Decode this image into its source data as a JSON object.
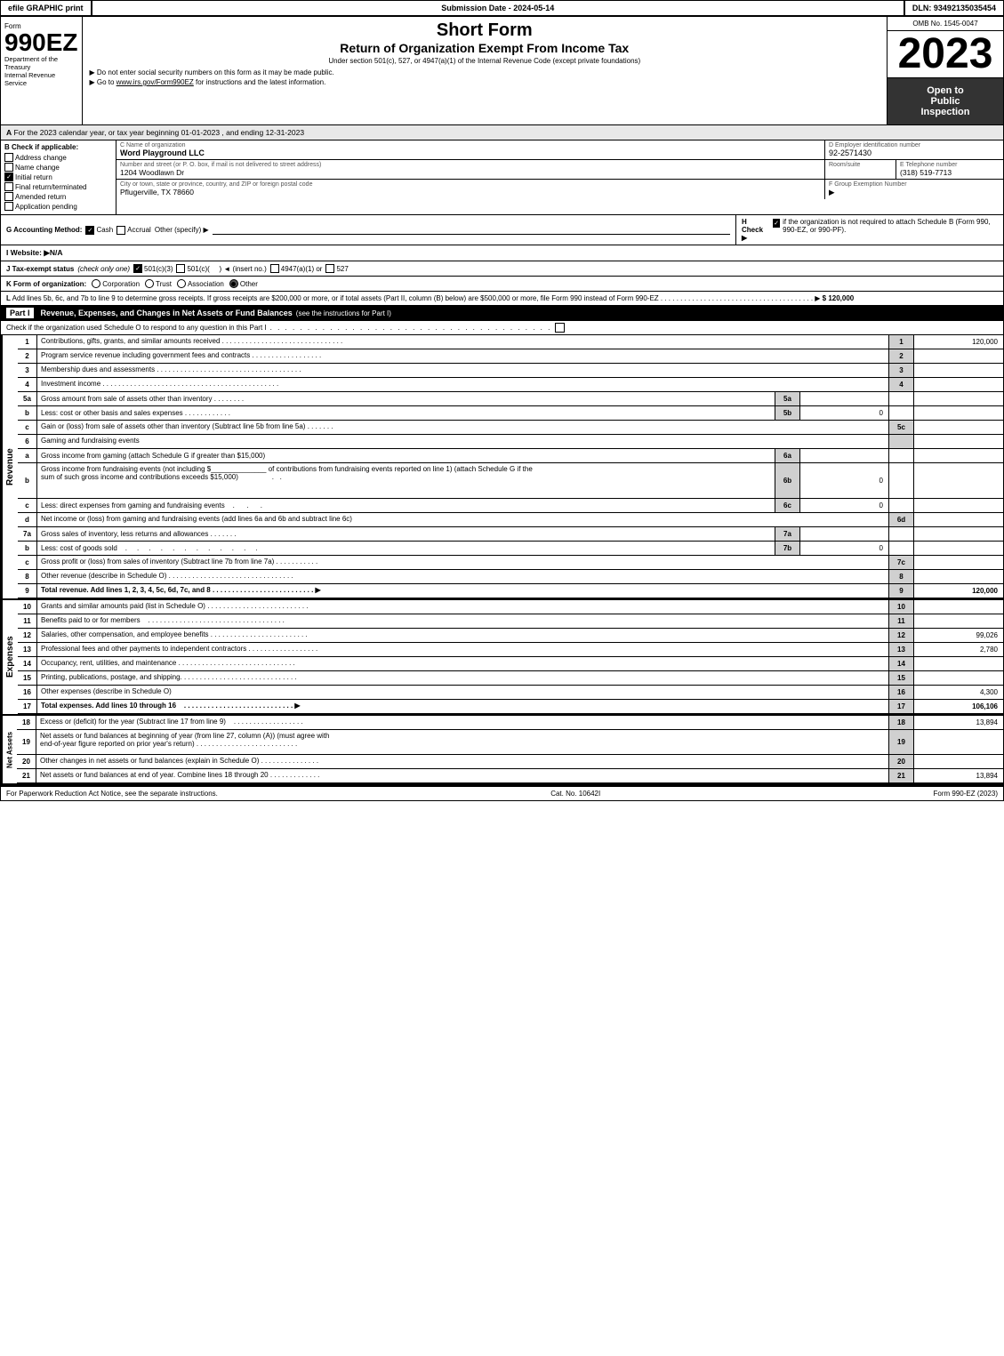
{
  "header": {
    "efile_label": "efile GRAPHIC print",
    "submission_label": "Submission Date - 2024-05-14",
    "dln_label": "DLN: 93492135035454"
  },
  "form": {
    "number": "990EZ",
    "dept_line1": "Department of the",
    "dept_line2": "Treasury",
    "dept_line3": "Internal Revenue",
    "dept_line4": "Service",
    "short_form": "Short Form",
    "main_title": "Return of Organization Exempt From Income Tax",
    "subtitle": "Under section 501(c), 527, or 4947(a)(1) of the Internal Revenue Code (except private foundations)",
    "instruction1": "▶ Do not enter social security numbers on this form as it may be made public.",
    "instruction2": "▶ Go to www.irs.gov/Form990EZ for instructions and the latest information.",
    "irs_link": "www.irs.gov/Form990EZ"
  },
  "omb": {
    "label": "OMB No. 1545-0047"
  },
  "year": {
    "value": "2023"
  },
  "open_inspection": {
    "line1": "Open to",
    "line2": "Public",
    "line3": "Inspection"
  },
  "section_a": {
    "label": "A",
    "text": "For the 2023 calendar year, or tax year beginning 01-01-2023 , and ending 12-31-2023"
  },
  "org_info": {
    "check_label": "B Check if applicable:",
    "address_change": "Address change",
    "name_change": "Name change",
    "initial_return": "Initial return",
    "final_return": "Final return/terminated",
    "amended_return": "Amended return",
    "application_pending": "Application pending",
    "initial_checked": true,
    "name_label": "C Name of organization",
    "name_value": "Word Playground LLC",
    "address_label": "Number and street (or P. O. box, if mail is not delivered to street address)",
    "address_value": "1204 Woodlawn Dr",
    "room_label": "Room/suite",
    "room_value": "",
    "city_label": "City or town, state or province, country, and ZIP or foreign postal code",
    "city_value": "Pflugerville, TX  78660",
    "ein_label": "D Employer identification number",
    "ein_value": "92-2571430",
    "phone_label": "E Telephone number",
    "phone_value": "(318) 519-7713",
    "group_label": "F Group Exemption Number",
    "group_value": "▶"
  },
  "accounting": {
    "label": "G Accounting Method:",
    "cash_label": "Cash",
    "cash_checked": true,
    "accrual_label": "Accrual",
    "accrual_checked": false,
    "other_label": "Other (specify) ▶"
  },
  "h_check": {
    "label": "H Check ▶",
    "checked": true,
    "text": "if the organization is not required to attach Schedule B (Form 990, 990-EZ, or 990-PF)."
  },
  "website": {
    "label": "I Website: ▶N/A"
  },
  "tax_exempt": {
    "label": "J Tax-exempt status",
    "note": "(check only one)",
    "options": [
      {
        "label": "501(c)(3)",
        "checked": true
      },
      {
        "label": "501(c)(",
        "checked": false
      },
      {
        "label": ") ◄ (insert no.)",
        "checked": false
      },
      {
        "label": "4947(a)(1) or",
        "checked": false
      },
      {
        "label": "527",
        "checked": false
      }
    ]
  },
  "form_of_org": {
    "label": "K Form of organization:",
    "options": [
      {
        "label": "Corporation",
        "checked": false
      },
      {
        "label": "Trust",
        "checked": false
      },
      {
        "label": "Association",
        "checked": false
      },
      {
        "label": "Other",
        "checked": true
      }
    ]
  },
  "gross_receipts": {
    "line_l": "L Add lines 5b, 6c, and 7b to line 9 to determine gross receipts. If gross receipts are $200,000 or more, or if total assets (Part II, column (B) below) are $500,000 or more, file Form 990 instead of Form 990-EZ",
    "dots": ". . . . . . . . . . . . . . . . . . . . . . . . . . . . . . . . . . . . . .",
    "arrow": "▶",
    "amount": "$ 120,000"
  },
  "part1": {
    "label": "Part I",
    "title": "Revenue, Expenses, and Changes in Net Assets or Fund Balances",
    "subtitle": "(see the instructions for Part I)",
    "check_text": "Check if the organization used Schedule O to respond to any question in this Part I",
    "rows": [
      {
        "num": "1",
        "desc": "Contributions, gifts, grants, and similar amounts received",
        "dots": true,
        "line": "1",
        "value": "120,000"
      },
      {
        "num": "2",
        "desc": "Program service revenue including government fees and contracts",
        "dots": true,
        "line": "2",
        "value": ""
      },
      {
        "num": "3",
        "desc": "Membership dues and assessments",
        "dots": true,
        "line": "3",
        "value": ""
      },
      {
        "num": "4",
        "desc": "Investment income",
        "dots": true,
        "line": "4",
        "value": ""
      },
      {
        "num": "5a",
        "desc": "Gross amount from sale of assets other than inventory",
        "sub_label": "5a",
        "sub_value": "",
        "line": "",
        "value": ""
      },
      {
        "num": "b",
        "desc": "Less: cost or other basis and sales expenses",
        "sub_label": "5b",
        "sub_value": "0",
        "line": "",
        "value": ""
      },
      {
        "num": "c",
        "desc": "Gain or (loss) from sale of assets other than inventory (Subtract line 5b from line 5a)",
        "dots": true,
        "line": "5c",
        "value": ""
      },
      {
        "num": "6",
        "desc": "Gaming and fundraising events",
        "line": "",
        "value": ""
      },
      {
        "num": "a",
        "desc": "Gross income from gaming (attach Schedule G if greater than $15,000)",
        "sub_label": "6a",
        "sub_value": "",
        "line": "",
        "value": ""
      },
      {
        "num": "b",
        "desc": "Gross income from fundraising events (not including $_____ of contributions from fundraising events reported on line 1) (attach Schedule G if the sum of such gross income and contributions exceeds $15,000)",
        "sub_label": "6b",
        "sub_value": "0",
        "line": "",
        "value": ""
      },
      {
        "num": "c",
        "desc": "Less: direct expenses from gaming and fundraising events",
        "sub_label": "6c",
        "sub_value": "0",
        "line": "",
        "value": ""
      },
      {
        "num": "d",
        "desc": "Net income or (loss) from gaming and fundraising events (add lines 6a and 6b and subtract line 6c)",
        "line": "6d",
        "value": ""
      },
      {
        "num": "7a",
        "desc": "Gross sales of inventory, less returns and allowances",
        "dots": true,
        "sub_label": "7a",
        "sub_value": "",
        "line": "",
        "value": ""
      },
      {
        "num": "b",
        "desc": "Less: cost of goods sold",
        "dots": true,
        "sub_label": "7b",
        "sub_value": "0",
        "line": "",
        "value": ""
      },
      {
        "num": "c",
        "desc": "Gross profit or (loss) from sales of inventory (Subtract line 7b from line 7a)",
        "dots": true,
        "line": "7c",
        "value": ""
      },
      {
        "num": "8",
        "desc": "Other revenue (describe in Schedule O)",
        "dots": true,
        "line": "8",
        "value": ""
      },
      {
        "num": "9",
        "desc": "Total revenue. Add lines 1, 2, 3, 4, 5c, 6d, 7c, and 8",
        "dots": true,
        "bold": true,
        "arrow": "▶",
        "line": "9",
        "value": "120,000"
      }
    ]
  },
  "expenses": {
    "rows": [
      {
        "num": "10",
        "desc": "Grants and similar amounts paid (list in Schedule O)",
        "dots": true,
        "line": "10",
        "value": ""
      },
      {
        "num": "11",
        "desc": "Benefits paid to or for members",
        "dots": true,
        "line": "11",
        "value": ""
      },
      {
        "num": "12",
        "desc": "Salaries, other compensation, and employee benefits",
        "dots": true,
        "line": "12",
        "value": "99,026"
      },
      {
        "num": "13",
        "desc": "Professional fees and other payments to independent contractors",
        "dots": true,
        "line": "13",
        "value": "2,780"
      },
      {
        "num": "14",
        "desc": "Occupancy, rent, utilities, and maintenance",
        "dots": true,
        "line": "14",
        "value": ""
      },
      {
        "num": "15",
        "desc": "Printing, publications, postage, and shipping.",
        "dots": true,
        "line": "15",
        "value": ""
      },
      {
        "num": "16",
        "desc": "Other expenses (describe in Schedule O)",
        "line": "16",
        "value": "4,300"
      },
      {
        "num": "17",
        "desc": "Total expenses. Add lines 10 through 16",
        "dots": true,
        "bold": true,
        "arrow": "▶",
        "line": "17",
        "value": "106,106"
      }
    ]
  },
  "net_assets_rows": [
    {
      "num": "18",
      "desc": "Excess or (deficit) for the year (Subtract line 17 from line 9)",
      "dots": true,
      "line": "18",
      "value": "13,894"
    },
    {
      "num": "19",
      "desc": "Net assets or fund balances at beginning of year (from line 27, column (A)) (must agree with end-of-year figure reported on prior year's return)",
      "dots": true,
      "line": "19",
      "value": ""
    },
    {
      "num": "20",
      "desc": "Other changes in net assets or fund balances (explain in Schedule O)",
      "dots": true,
      "line": "20",
      "value": ""
    },
    {
      "num": "21",
      "desc": "Net assets or fund balances at end of year. Combine lines 18 through 20",
      "dots": true,
      "line": "21",
      "value": "13,894"
    }
  ],
  "footer": {
    "left": "For Paperwork Reduction Act Notice, see the separate instructions.",
    "center": "Cat. No. 10642I",
    "right": "Form 990-EZ (2023)"
  }
}
